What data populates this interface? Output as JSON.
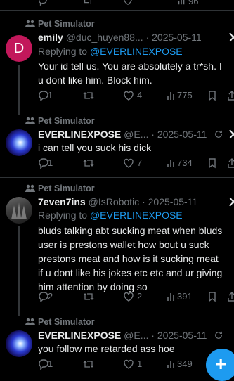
{
  "top_partial": {
    "count": "96"
  },
  "posts": [
    {
      "community": "Pet Simulator",
      "avatar_letter": "D",
      "name": "emily",
      "handle": "@duc_huyen88...",
      "date": "2025-05-11",
      "replying_prefix": "Replying to",
      "replying_to": "@EVERLINEXPOSE",
      "text_lines": [
        "Your id tell us. You are absolutely a tr*sh. I",
        "u dont like him. Block him."
      ],
      "stats": {
        "replies": "1",
        "likes": "4",
        "views": "775"
      }
    },
    {
      "community": "Pet Simulator",
      "name": "EVERLINEXPOSE",
      "handle": "@E...",
      "date": "2025-05-11",
      "text_lines": [
        "i can tell you suck his dick"
      ],
      "stats": {
        "replies": "1",
        "likes": "7",
        "views": "734"
      }
    },
    {
      "community": "Pet Simulator",
      "name": "7even7ins",
      "handle": "@IsRobotic",
      "date": "2025-05-11",
      "replying_prefix": "Replying to",
      "replying_to": "@EVERLINEXPOSE",
      "text_lines": [
        "bluds talking abt sucking meat when bluds",
        "user is prestons wallet how bout u suck",
        "prestons meat and how is it sucking meat",
        "if u dont like his jokes etc etc and ur giving",
        "him attention by doing so"
      ],
      "stats": {
        "replies": "2",
        "likes": "2",
        "views": "391"
      }
    },
    {
      "community": "Pet Simulator",
      "name": "EVERLINEXPOSE",
      "handle": "@E...",
      "date": "2025-05-11",
      "text_lines": [
        "you follow me retarded ass hoe"
      ],
      "stats": {
        "replies": "1",
        "likes": "1",
        "views": "349"
      }
    }
  ],
  "compose_button": {
    "label": "+"
  },
  "colors": {
    "accent": "#1d9bf0",
    "muted": "#71767b",
    "text": "#e7e9ea",
    "background": "#000000"
  },
  "icons": [
    "community-icon",
    "more-icon",
    "reply-icon",
    "repost-icon",
    "like-icon",
    "views-icon",
    "bookmark-icon",
    "share-icon",
    "grok-icon",
    "compose-icon"
  ]
}
